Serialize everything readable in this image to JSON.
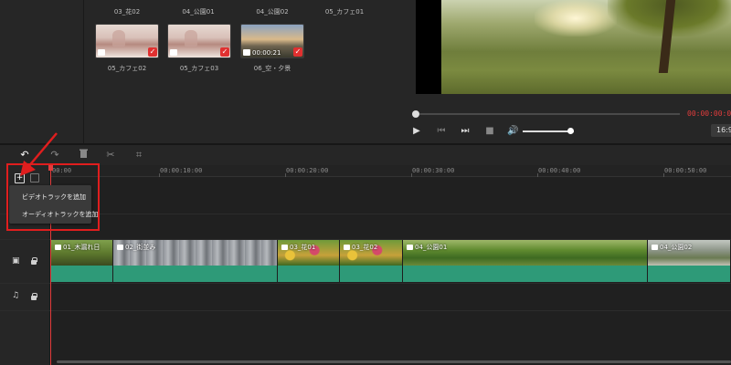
{
  "media": {
    "top_labels": [
      "03_花02",
      "04_公園01",
      "04_公園02",
      "05_カフェ01"
    ],
    "items": [
      {
        "label": "05_カフェ02",
        "kind": "image",
        "duration": ""
      },
      {
        "label": "05_カフェ03",
        "kind": "image",
        "duration": ""
      },
      {
        "label": "06_空・夕景",
        "kind": "video",
        "duration": "00:00:21"
      }
    ]
  },
  "preview": {
    "timecode": "00:00:00:00",
    "aspect": "16:9",
    "progress": 0.0,
    "volume": 0.92
  },
  "toolbar": {
    "undo": "↶",
    "redo": "↷",
    "delete": "🗑",
    "cut": "✂",
    "crop": "⌗"
  },
  "timeline": {
    "ruler": [
      "00:00",
      "00:00:10:00",
      "00:00:20:00",
      "00:00:30:00",
      "00:00:40:00",
      "00:00:50:00"
    ],
    "clips": [
      {
        "label": "01_木漏れ日"
      },
      {
        "label": "02_街並み"
      },
      {
        "label": "03_花01"
      },
      {
        "label": "03_花02"
      },
      {
        "label": "04_公園01"
      },
      {
        "label": "04_公園02"
      }
    ]
  },
  "popup": {
    "add_video_track": "ビデオトラックを追加",
    "add_audio_track": "オーディオトラックを追加"
  },
  "colors": {
    "accent_red": "#e23c3c",
    "clip_green": "#2e9a78",
    "annotation_red": "#e01e1e"
  }
}
